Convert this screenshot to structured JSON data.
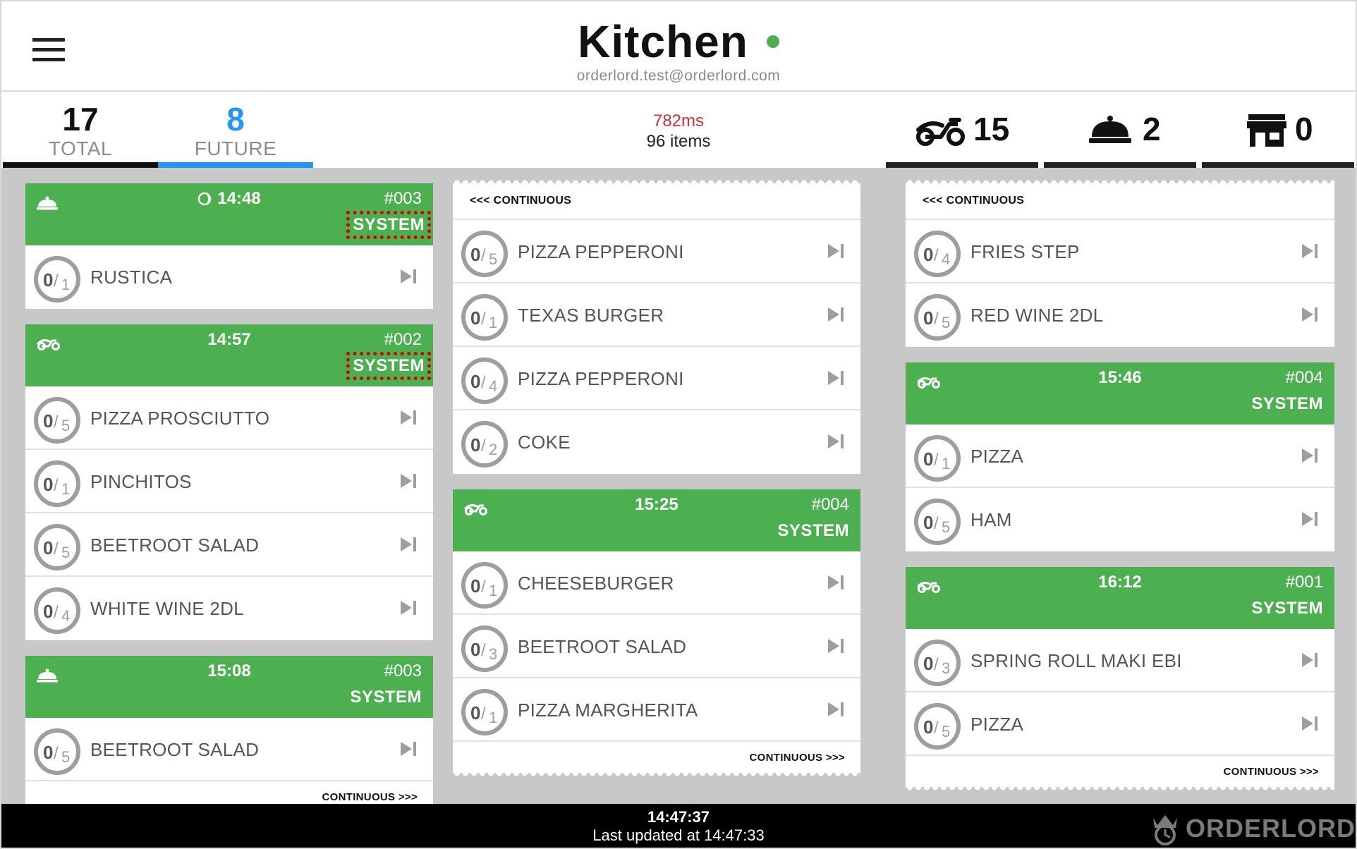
{
  "header": {
    "title": "Kitchen",
    "subtitle": "orderlord.test@orderlord.com"
  },
  "stats": {
    "total": {
      "value": "17",
      "label": "TOTAL"
    },
    "future": {
      "value": "8",
      "label": "FUTURE"
    },
    "latency": "782ms",
    "items": "96 items",
    "delivery": "15",
    "takeaway": "2",
    "dine_in": "0"
  },
  "colors": {
    "green": "#4caf50",
    "blue": "#2196f3",
    "red": "#d32f2f",
    "board": "#c8c8c8"
  },
  "columns": [
    {
      "tickets": [
        {
          "type_icon": "cloche-icon",
          "time": "14:48",
          "time_icon": "moon-clock-icon",
          "number": "#003",
          "source": "SYSTEM",
          "source_flagged": true,
          "items": [
            {
              "done": "0",
              "total": "1",
              "name": "RUSTICA"
            }
          ]
        },
        {
          "type_icon": "scooter-icon",
          "time": "14:57",
          "number": "#002",
          "source": "SYSTEM",
          "source_flagged": true,
          "items": [
            {
              "done": "0",
              "total": "5",
              "name": "PIZZA PROSCIUTTO"
            },
            {
              "done": "0",
              "total": "1",
              "name": "PINCHITOS"
            },
            {
              "done": "0",
              "total": "5",
              "name": "BEETROOT SALAD"
            },
            {
              "done": "0",
              "total": "4",
              "name": "WHITE WINE 2DL"
            }
          ]
        },
        {
          "type_icon": "cloche-icon",
          "time": "15:08",
          "number": "#003",
          "source": "SYSTEM",
          "source_flagged": false,
          "items": [
            {
              "done": "0",
              "total": "5",
              "name": "BEETROOT SALAD"
            }
          ],
          "continues": "CONTINUOUS >>>"
        }
      ]
    },
    {
      "tickets": [
        {
          "continued": "<<< CONTINUOUS",
          "items": [
            {
              "done": "0",
              "total": "5",
              "name": "PIZZA PEPPERONI"
            },
            {
              "done": "0",
              "total": "1",
              "name": "TEXAS BURGER"
            },
            {
              "done": "0",
              "total": "4",
              "name": "PIZZA PEPPERONI"
            },
            {
              "done": "0",
              "total": "2",
              "name": "COKE"
            }
          ]
        },
        {
          "type_icon": "scooter-icon",
          "time": "15:25",
          "number": "#004",
          "source": "SYSTEM",
          "source_flagged": false,
          "items": [
            {
              "done": "0",
              "total": "1",
              "name": "CHEESEBURGER"
            },
            {
              "done": "0",
              "total": "3",
              "name": "BEETROOT SALAD"
            },
            {
              "done": "0",
              "total": "1",
              "name": "PIZZA MARGHERITA"
            }
          ],
          "continues": "CONTINUOUS >>>"
        }
      ]
    },
    {
      "tickets": [
        {
          "continued": "<<< CONTINUOUS",
          "items": [
            {
              "done": "0",
              "total": "4",
              "name": "FRIES STEP"
            },
            {
              "done": "0",
              "total": "5",
              "name": "RED WINE 2DL"
            }
          ]
        },
        {
          "type_icon": "scooter-icon",
          "time": "15:46",
          "number": "#004",
          "source": "SYSTEM",
          "source_flagged": false,
          "items": [
            {
              "done": "0",
              "total": "1",
              "name": "PIZZA"
            },
            {
              "done": "0",
              "total": "5",
              "name": "HAM"
            }
          ]
        },
        {
          "type_icon": "scooter-icon",
          "time": "16:12",
          "number": "#001",
          "source": "SYSTEM",
          "source_flagged": false,
          "items": [
            {
              "done": "0",
              "total": "3",
              "name": "SPRING ROLL MAKI EBI"
            },
            {
              "done": "0",
              "total": "5",
              "name": "PIZZA"
            }
          ],
          "continues": "CONTINUOUS >>>"
        }
      ]
    }
  ],
  "footer": {
    "clock": "14:47:37",
    "updated": "Last updated at 14:47:33",
    "brand": "ORDERLORD"
  }
}
